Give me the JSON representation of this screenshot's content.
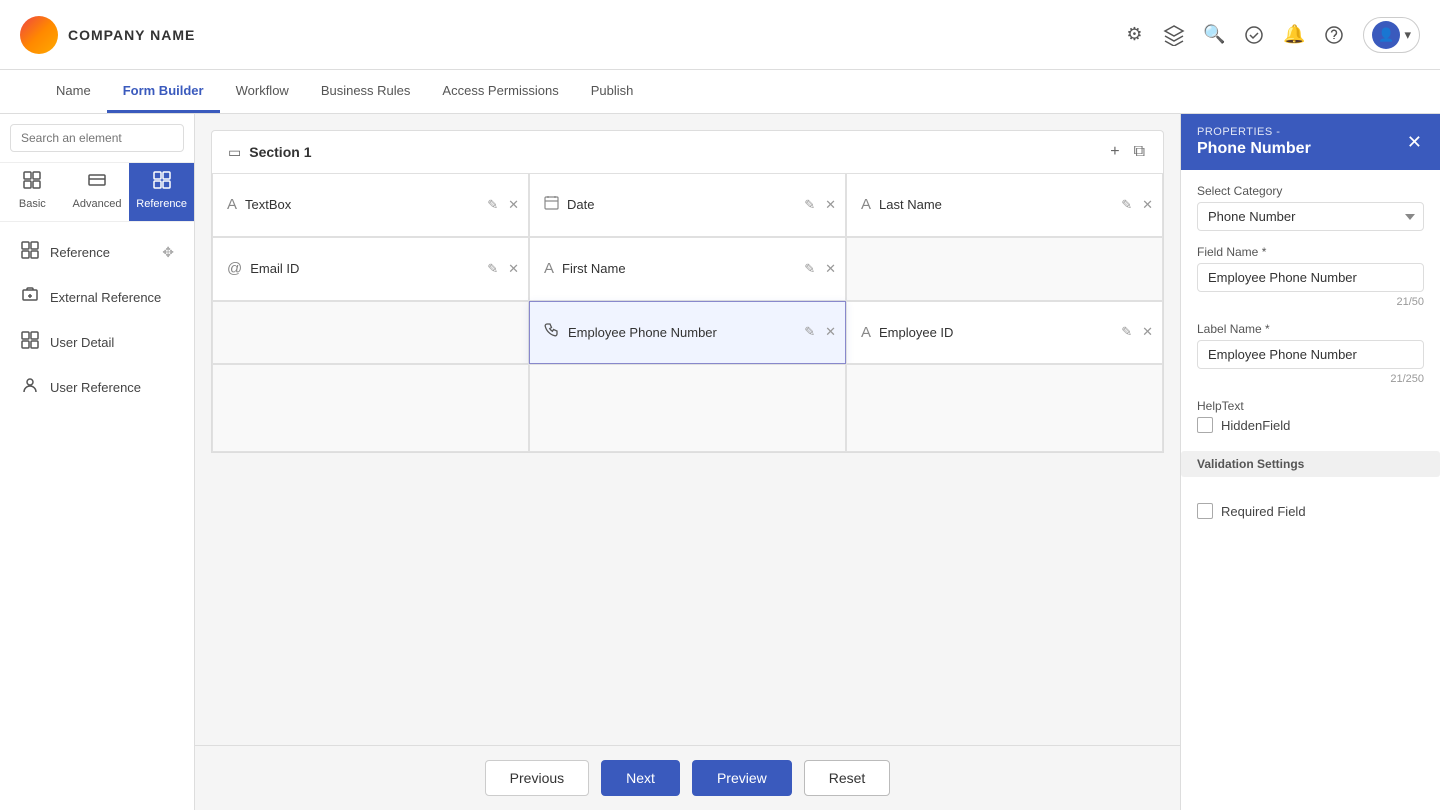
{
  "header": {
    "company_name": "COMPANY NAME"
  },
  "tabs": [
    {
      "id": "name",
      "label": "Name",
      "active": false
    },
    {
      "id": "form_builder",
      "label": "Form Builder",
      "active": true
    },
    {
      "id": "workflow",
      "label": "Workflow",
      "active": false
    },
    {
      "id": "business_rules",
      "label": "Business Rules",
      "active": false
    },
    {
      "id": "access_permissions",
      "label": "Access Permissions",
      "active": false
    },
    {
      "id": "publish",
      "label": "Publish",
      "active": false
    }
  ],
  "sidebar": {
    "search_placeholder": "Search an element",
    "element_tabs": [
      {
        "id": "basic",
        "label": "Basic",
        "icon": "⊞"
      },
      {
        "id": "advanced",
        "label": "Advanced",
        "icon": "⊟"
      },
      {
        "id": "reference",
        "label": "Reference",
        "icon": "✓",
        "active": true
      }
    ],
    "items": [
      {
        "id": "reference",
        "label": "Reference",
        "icon": "⊞"
      },
      {
        "id": "external_reference",
        "label": "External Reference",
        "icon": "⊡"
      },
      {
        "id": "user_detail",
        "label": "User Detail",
        "icon": "⊞"
      },
      {
        "id": "user_reference",
        "label": "User Reference",
        "icon": "⊞"
      }
    ]
  },
  "canvas": {
    "section_title": "Section 1",
    "fields": [
      {
        "id": "textbox",
        "label": "TextBox",
        "icon": "A",
        "col": 1,
        "row": 1
      },
      {
        "id": "date",
        "label": "Date",
        "icon": "📅",
        "col": 2,
        "row": 1
      },
      {
        "id": "last_name",
        "label": "Last Name",
        "icon": "A",
        "col": 3,
        "row": 1
      },
      {
        "id": "email_id",
        "label": "Email ID",
        "icon": "@",
        "col": 1,
        "row": 2
      },
      {
        "id": "first_name",
        "label": "First Name",
        "icon": "A",
        "col": 2,
        "row": 2
      },
      {
        "id": "employee_phone",
        "label": "Employee Phone Number",
        "icon": "📞",
        "col": 2,
        "row": 3,
        "highlighted": true
      },
      {
        "id": "employee_id",
        "label": "Employee ID",
        "icon": "A",
        "col": 3,
        "row": 3
      }
    ]
  },
  "properties_panel": {
    "subtitle": "PROPERTIES -",
    "title": "Phone Number",
    "select_category_label": "Select Category",
    "select_category_value": "Phone Number",
    "field_name_label": "Field Name *",
    "field_name_value": "Employee Phone Number",
    "field_name_char_count": "21/50",
    "label_name_label": "Label Name *",
    "label_name_value": "Employee Phone Number",
    "label_name_char_count": "21/250",
    "helptext_label": "HelpText",
    "hidden_field_label": "HiddenField",
    "validation_settings_label": "Validation Settings",
    "required_field_label": "Required Field"
  },
  "bottom_bar": {
    "previous_label": "Previous",
    "next_label": "Next",
    "preview_label": "Preview",
    "reset_label": "Reset"
  }
}
